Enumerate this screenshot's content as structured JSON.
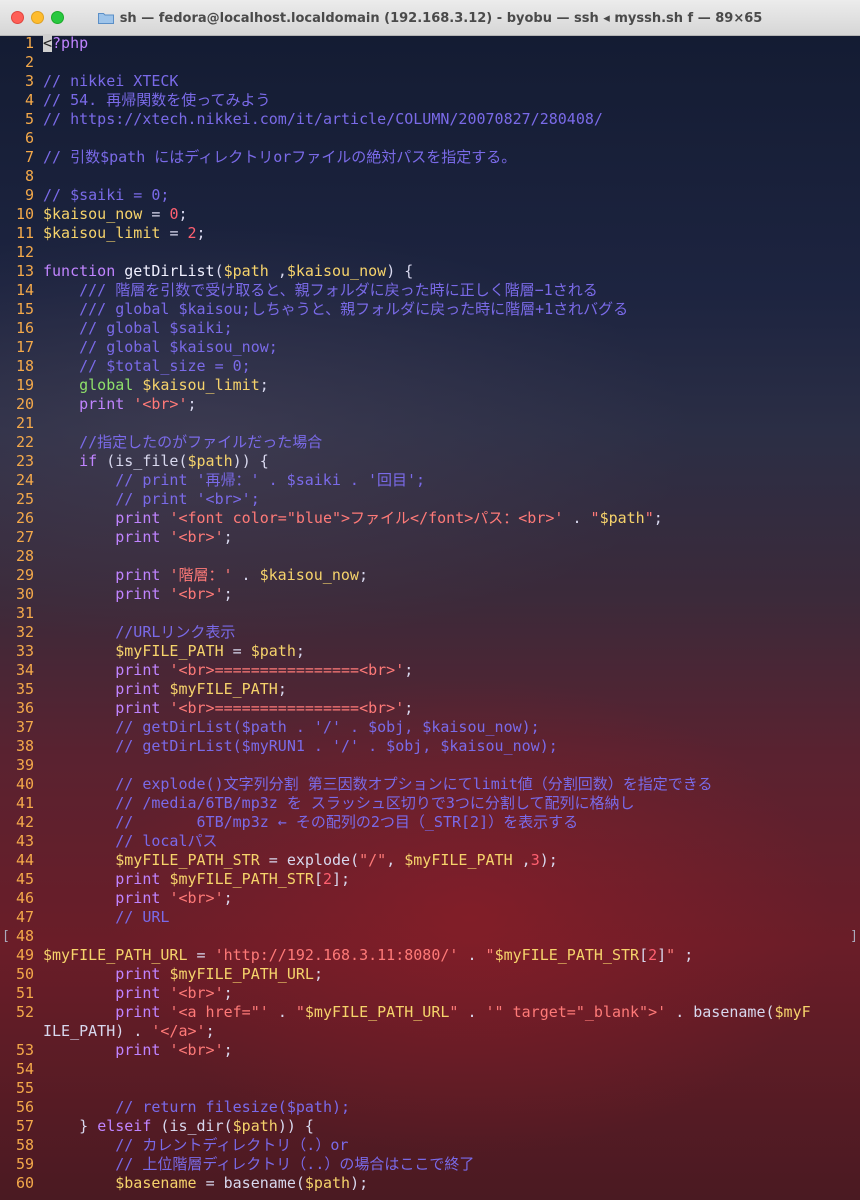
{
  "window": {
    "title": "sh — fedora@localhost.localdomain (192.168.3.12) - byobu — ssh ◂ myssh.sh f — 89×65"
  },
  "colors": {
    "line_number": "#f4a94a",
    "comment": "#7a6ae8",
    "keyword": "#c084ff",
    "string": "#ff7a78",
    "variable": "#f6d36b",
    "func": "#f0f0ff",
    "number": "#ff6070",
    "plain": "#d8d8ee",
    "global": "#8fe06a",
    "cursor": "#cfcfcf"
  },
  "editor": {
    "scroll_markers": {
      "left": "[",
      "right": "]"
    },
    "cursor_char": "<",
    "lines": [
      {
        "n": "1",
        "text": "?php",
        "cursor": true
      },
      {
        "n": "2",
        "text": ""
      },
      {
        "n": "3",
        "text": "// nikkei XTECK"
      },
      {
        "n": "4",
        "text": "// 54. 再帰関数を使ってみよう"
      },
      {
        "n": "5",
        "text": "// https://xtech.nikkei.com/it/article/COLUMN/20070827/280408/"
      },
      {
        "n": "6",
        "text": ""
      },
      {
        "n": "7",
        "text": "// 引数$path にはディレクトリorファイルの絶対パスを指定する。"
      },
      {
        "n": "8",
        "text": ""
      },
      {
        "n": "9",
        "text": "// $saiki = 0;"
      },
      {
        "n": "10",
        "text": "$kaisou_now = 0;"
      },
      {
        "n": "11",
        "text": "$kaisou_limit = 2;"
      },
      {
        "n": "12",
        "text": ""
      },
      {
        "n": "13",
        "text": "function getDirList($path ,$kaisou_now) {"
      },
      {
        "n": "14",
        "text": "    /// 階層を引数で受け取ると、親フォルダに戻った時に正しく階層−1される"
      },
      {
        "n": "15",
        "text": "    /// global $kaisou;しちゃうと、親フォルダに戻った時に階層+1されバグる"
      },
      {
        "n": "16",
        "text": "    // global $saiki;"
      },
      {
        "n": "17",
        "text": "    // global $kaisou_now;"
      },
      {
        "n": "18",
        "text": "    // $total_size = 0;"
      },
      {
        "n": "19",
        "text": "    global $kaisou_limit;"
      },
      {
        "n": "20",
        "text": "    print '<br>';"
      },
      {
        "n": "21",
        "text": ""
      },
      {
        "n": "22",
        "text": "    //指定したのがファイルだった場合"
      },
      {
        "n": "23",
        "text": "    if (is_file($path)) {"
      },
      {
        "n": "24",
        "text": "        // print '再帰：' . $saiki . '回目';"
      },
      {
        "n": "25",
        "text": "        // print '<br>';"
      },
      {
        "n": "26",
        "text": "        print '<font color=\"blue\">ファイル</font>パス：<br>' . \"$path\";"
      },
      {
        "n": "27",
        "text": "        print '<br>';"
      },
      {
        "n": "28",
        "text": ""
      },
      {
        "n": "29",
        "text": "        print '階層：' . $kaisou_now;"
      },
      {
        "n": "30",
        "text": "        print '<br>';"
      },
      {
        "n": "31",
        "text": ""
      },
      {
        "n": "32",
        "text": "        //URLリンク表示"
      },
      {
        "n": "33",
        "text": "        $myFILE_PATH = $path;"
      },
      {
        "n": "34",
        "text": "        print '<br>================<br>';"
      },
      {
        "n": "35",
        "text": "        print $myFILE_PATH;"
      },
      {
        "n": "36",
        "text": "        print '<br>================<br>';"
      },
      {
        "n": "37",
        "text": "        // getDirList($path . '/' . $obj, $kaisou_now);"
      },
      {
        "n": "38",
        "text": "        // getDirList($myRUN1 . '/' . $obj, $kaisou_now);"
      },
      {
        "n": "39",
        "text": ""
      },
      {
        "n": "40",
        "text": "        // explode()文字列分割 第三因数オプションにてlimit値（分割回数）を指定できる"
      },
      {
        "n": "41",
        "text": "        // /media/6TB/mp3z を スラッシュ区切りで3つに分割して配列に格納し"
      },
      {
        "n": "42",
        "text": "        //       6TB/mp3z ← その配列の2つ目（_STR[2]）を表示する"
      },
      {
        "n": "43",
        "text": "        // localパス"
      },
      {
        "n": "44",
        "text": "        $myFILE_PATH_STR = explode(\"/\", $myFILE_PATH ,3);"
      },
      {
        "n": "45",
        "text": "        print $myFILE_PATH_STR[2];"
      },
      {
        "n": "46",
        "text": "        print '<br>';"
      },
      {
        "n": "47",
        "text": "        // URL"
      },
      {
        "n": "48",
        "text": ""
      },
      {
        "n": "49",
        "text": "$myFILE_PATH_URL = 'http://192.168.3.11:8080/' . \"$myFILE_PATH_STR[2]\" ;"
      },
      {
        "n": "50",
        "text": "        print $myFILE_PATH_URL;"
      },
      {
        "n": "51",
        "text": "        print '<br>';"
      },
      {
        "n": "52",
        "text": "        print '<a href=\"' . \"$myFILE_PATH_URL\" . '\" target=\"_blank\">' . basename($myF"
      },
      {
        "n": "",
        "text": "ILE_PATH) . '</a>';",
        "wrap": true
      },
      {
        "n": "53",
        "text": "        print '<br>';"
      },
      {
        "n": "54",
        "text": ""
      },
      {
        "n": "55",
        "text": ""
      },
      {
        "n": "56",
        "text": "        // return filesize($path);"
      },
      {
        "n": "57",
        "text": "    } elseif (is_dir($path)) {"
      },
      {
        "n": "58",
        "text": "        // カレントディレクトリ（.）or"
      },
      {
        "n": "59",
        "text": "        // 上位階層ディレクトリ（..）の場合はここで終了"
      },
      {
        "n": "60",
        "text": "        $basename = basename($path);"
      }
    ]
  }
}
